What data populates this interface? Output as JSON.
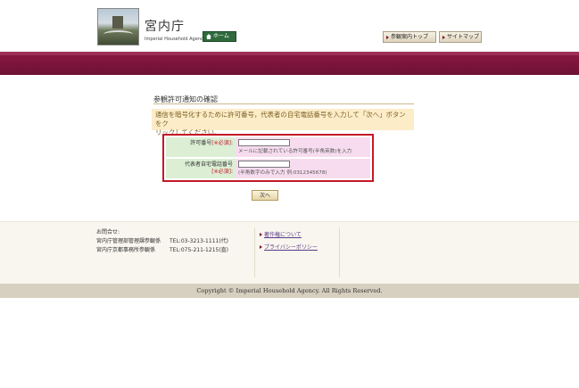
{
  "header": {
    "site_title": "宮内庁",
    "site_subtitle": "Imperial Household Agency",
    "home_label": "ホーム",
    "nav_links": [
      "参観案内トップ",
      "サイトマップ"
    ]
  },
  "main": {
    "heading": "参観許可通知の確認",
    "instruction_line1": "通信を暗号化するために許可番号，代表者の自宅電話番号を入力して「次へ」ボタンをク",
    "instruction_line2": "リックしてください。",
    "fields": [
      {
        "label": "許可番号",
        "required": "[※必須]",
        "hint": "メールに記載されている許可番号(半角英数)を入力"
      },
      {
        "label": "代表者自宅電話番号",
        "required": "[※必須]",
        "hint": "(半角数字のみで入力 例:0312345678)"
      }
    ],
    "next_label": "次へ"
  },
  "footer": {
    "contact_title": "お問合せ:",
    "contacts": [
      {
        "org": "宮内庁管理部管理課参観係",
        "tel": "TEL:03-3213-1111(代)"
      },
      {
        "org": "宮内庁京都事務所参観係",
        "tel": "TEL:075-211-1215(直)"
      }
    ],
    "links": [
      "著作権について",
      "プライバシーポリシー"
    ],
    "copyright": "Copyright © Imperial Household Agency. All Rights Reserved."
  },
  "colors": {
    "banner": "#7b1538",
    "required": "#c41827",
    "label_bg": "#dcefd5",
    "field_bg": "#f7dcef"
  }
}
